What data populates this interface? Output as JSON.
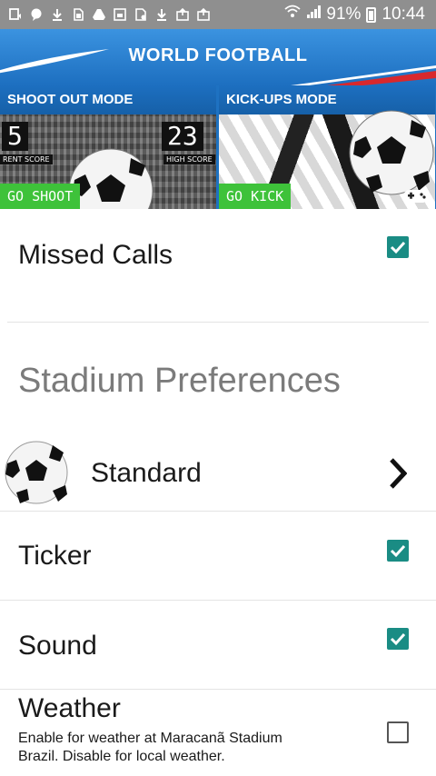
{
  "status_bar": {
    "left_icons": [
      "screen-record-icon",
      "chat-icon",
      "download-icon",
      "sim-icon",
      "drive-icon",
      "image-icon",
      "file-icon",
      "download-icon",
      "photo-upload-icon",
      "photo-upload-icon"
    ],
    "battery_percent": "91%",
    "time": "10:44"
  },
  "banner": {
    "title": "WORLD FOOTBALL",
    "left_panel": {
      "mode": "SHOOT OUT MODE",
      "current_score": "5",
      "current_score_label": "RENT SCORE",
      "high_score": "23",
      "high_score_label": "HIGH SCORE",
      "button": "GO SHOOT"
    },
    "right_panel": {
      "mode": "KICK-UPS MODE",
      "button": "GO KICK"
    }
  },
  "settings": {
    "missed_calls": {
      "label": "Missed Calls",
      "checked": true
    },
    "section_title": "Stadium Preferences",
    "stadium": {
      "label": "Standard"
    },
    "ticker": {
      "label": "Ticker",
      "checked": true
    },
    "sound": {
      "label": "Sound",
      "checked": true
    },
    "weather": {
      "label": "Weather",
      "checked": false,
      "description": "Enable for weather at Maracanã Stadium Brazil. Disable for local weather."
    }
  },
  "colors": {
    "accent": "#1a8c84",
    "banner_blue": "#1e72c2",
    "go_button_green": "#3ec23a",
    "status_bar": "#8f8f8f"
  }
}
